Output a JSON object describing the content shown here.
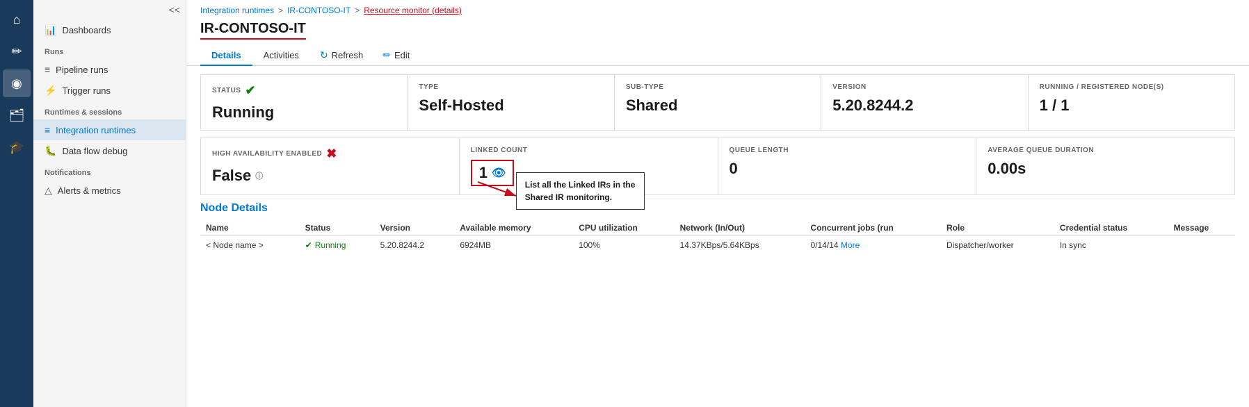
{
  "sidebar": {
    "collapse_label": "<<",
    "icons": [
      {
        "name": "home-icon",
        "symbol": "⌂",
        "active": false
      },
      {
        "name": "pencil-icon",
        "symbol": "✏",
        "active": false
      },
      {
        "name": "monitor-icon",
        "symbol": "◎",
        "active": true
      },
      {
        "name": "briefcase-icon",
        "symbol": "💼",
        "active": false
      },
      {
        "name": "graduation-icon",
        "symbol": "🎓",
        "active": false
      }
    ]
  },
  "nav": {
    "collapse_label": "<<",
    "sections": [
      {
        "label": "Runs",
        "items": [
          {
            "label": "Pipeline runs",
            "icon": "≡",
            "active": false
          },
          {
            "label": "Trigger runs",
            "icon": "⚡",
            "active": false
          }
        ]
      },
      {
        "label": "Runtimes & sessions",
        "items": [
          {
            "label": "Integration runtimes",
            "icon": "≡",
            "active": true
          },
          {
            "label": "Data flow debug",
            "icon": "🐛",
            "active": false
          }
        ]
      },
      {
        "label": "Notifications",
        "items": [
          {
            "label": "Alerts & metrics",
            "icon": "△",
            "active": false
          }
        ]
      }
    ],
    "top_items": [
      {
        "label": "Dashboards",
        "icon": "📊",
        "active": false
      }
    ]
  },
  "breadcrumb": {
    "items": [
      {
        "label": "Integration runtimes",
        "link": true
      },
      {
        "label": "IR-CONTOSO-IT",
        "link": true
      },
      {
        "label": "Resource monitor (details)",
        "current": true
      }
    ]
  },
  "page": {
    "title": "IR-CONTOSO-IT",
    "tabs": [
      {
        "label": "Details",
        "active": true
      },
      {
        "label": "Activities",
        "active": false
      }
    ],
    "actions": [
      {
        "label": "Refresh",
        "icon": "↻"
      },
      {
        "label": "Edit",
        "icon": "✏"
      }
    ]
  },
  "cards_row1": [
    {
      "label": "STATUS",
      "value": "Running",
      "has_icon": true,
      "icon_type": "green"
    },
    {
      "label": "TYPE",
      "value": "Self-Hosted"
    },
    {
      "label": "SUB-TYPE",
      "value": "Shared"
    },
    {
      "label": "VERSION",
      "value": "5.20.8244.2"
    },
    {
      "label": "RUNNING / REGISTERED NODE(S)",
      "value": "1 / 1"
    }
  ],
  "cards_row2": [
    {
      "label": "HIGH AVAILABILITY ENABLED",
      "value": "False",
      "has_icon": true,
      "icon_type": "red",
      "has_info": true
    },
    {
      "label": "LINKED COUNT",
      "value": "1",
      "is_linked_count": true,
      "tooltip": "List all the Linked IRs in the Shared IR monitoring."
    },
    {
      "label": "QUEUE LENGTH",
      "value": "0"
    },
    {
      "label": "AVERAGE QUEUE DURATION",
      "value": "0.00s"
    }
  ],
  "node_details": {
    "title": "Node Details",
    "columns": [
      "Name",
      "Status",
      "Version",
      "Available memory",
      "CPU utilization",
      "Network (In/Out)",
      "Concurrent jobs (run",
      "Role",
      "Credential status",
      "Message"
    ],
    "rows": [
      {
        "name": "< Node name >",
        "status": "Running",
        "version": "5.20.8244.2",
        "memory": "6924MB",
        "cpu": "100%",
        "network": "14.37KBps/5.64KBps",
        "concurrent": "0/14/14",
        "more": "More",
        "role": "Dispatcher/worker",
        "credential": "In sync",
        "message": ""
      }
    ]
  }
}
